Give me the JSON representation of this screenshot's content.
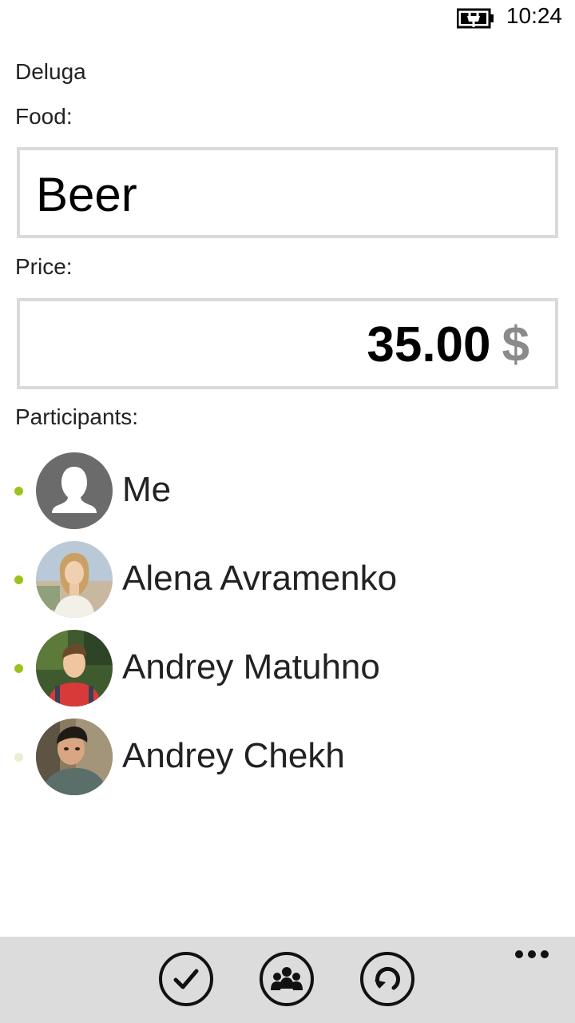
{
  "status_bar": {
    "time": "10:24",
    "battery_icon": "battery-charging-icon"
  },
  "app": {
    "title": "Deluga"
  },
  "form": {
    "food_label": "Food:",
    "food_value": "Beer",
    "price_label": "Price:",
    "price_value": "35.00",
    "currency": "$",
    "participants_label": "Participants:"
  },
  "participants": [
    {
      "name": "Me",
      "selected": true,
      "avatar": "default-person-icon"
    },
    {
      "name": "Alena Avramenko",
      "selected": true,
      "avatar": "photo"
    },
    {
      "name": "Andrey Matuhno",
      "selected": true,
      "avatar": "photo"
    },
    {
      "name": "Andrey Chekh",
      "selected": false,
      "avatar": "photo"
    }
  ],
  "app_bar": {
    "buttons": [
      {
        "icon": "check-icon"
      },
      {
        "icon": "people-icon"
      },
      {
        "icon": "refresh-icon"
      }
    ],
    "more_icon": "ellipsis-icon"
  },
  "colors": {
    "accent": "#9ac31c",
    "accent_inactive": "#e8efd2",
    "border": "#dadada",
    "app_bar": "#dcdcdc",
    "currency": "#8a8a8a"
  }
}
